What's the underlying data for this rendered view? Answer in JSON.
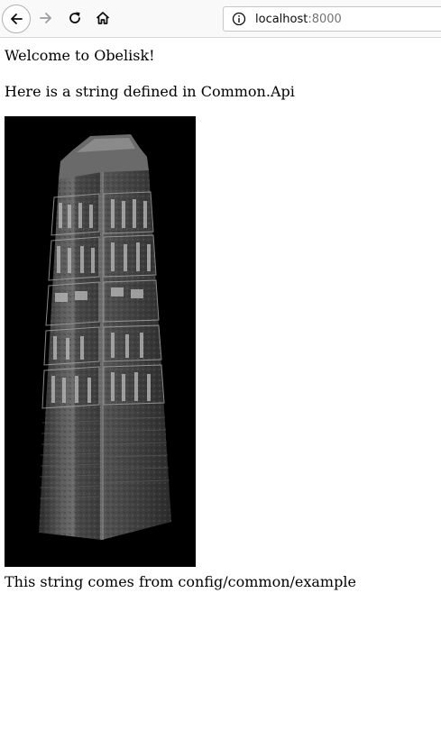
{
  "browser": {
    "url_host": "localhost",
    "url_port": ":8000",
    "icons": {
      "back": "back-arrow-icon",
      "forward": "forward-arrow-icon",
      "reload": "reload-icon",
      "home": "home-icon",
      "info": "info-icon"
    }
  },
  "page": {
    "welcome": "Welcome to Obelisk!",
    "common_api": "Here is a string defined in Common.Api",
    "config_string": "This string comes from config/common/example",
    "image_subject": "obelisk-image"
  }
}
